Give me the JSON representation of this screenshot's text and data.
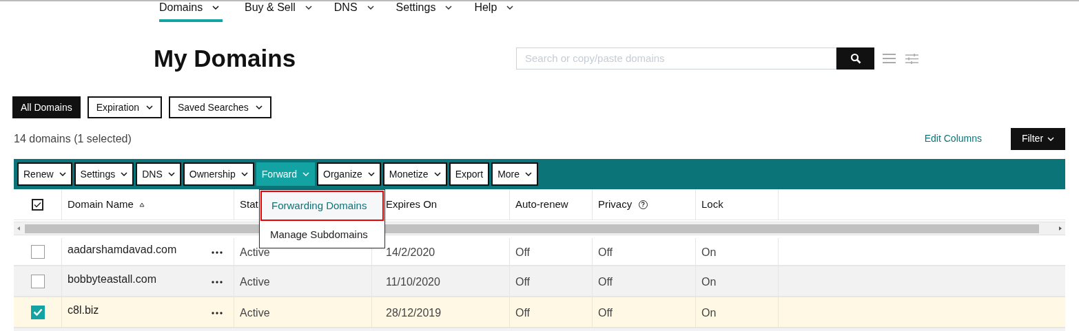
{
  "nav": [
    {
      "label": "Domains",
      "selected": true
    },
    {
      "label": "Buy & Sell",
      "selected": false
    },
    {
      "label": "DNS",
      "selected": false
    },
    {
      "label": "Settings",
      "selected": false
    },
    {
      "label": "Help",
      "selected": false
    }
  ],
  "title": "My Domains",
  "search": {
    "placeholder": "Search or copy/paste domains"
  },
  "filters": [
    {
      "label": "All Domains",
      "selected": true,
      "caret": false
    },
    {
      "label": "Expiration",
      "selected": false,
      "caret": true
    },
    {
      "label": "Saved Searches",
      "selected": false,
      "caret": true
    }
  ],
  "summary": "14 domains (1 selected)",
  "edit_columns": "Edit Columns",
  "filter_button": "Filter",
  "actions": [
    {
      "label": "Renew",
      "selected": false,
      "caret": true
    },
    {
      "label": "Settings",
      "selected": false,
      "caret": true
    },
    {
      "label": "DNS",
      "selected": false,
      "caret": true
    },
    {
      "label": "Ownership",
      "selected": false,
      "caret": true
    },
    {
      "label": "Forward",
      "selected": true,
      "caret": true
    },
    {
      "label": "Organize",
      "selected": false,
      "caret": true
    },
    {
      "label": "Monetize",
      "selected": false,
      "caret": true
    },
    {
      "label": "Export",
      "selected": false,
      "caret": false
    },
    {
      "label": "More",
      "selected": false,
      "caret": true
    }
  ],
  "menu": [
    {
      "label": "Forwarding Domains",
      "selected": true
    },
    {
      "label": "Manage Subdomains",
      "selected": false
    }
  ],
  "table": {
    "select_all": {
      "checked": true
    },
    "columns": [
      "Domain Name",
      "Stat",
      "Expires On",
      "Auto-renew",
      "Privacy",
      "Lock"
    ],
    "rows": [
      {
        "checked": false,
        "cells": [
          "aadarshamdavad.com",
          "Active",
          "14/2/2020",
          "Off",
          "Off",
          "On"
        ]
      },
      {
        "checked": false,
        "cells": [
          "bobbyteastall.com",
          "Active",
          "11/10/2020",
          "Off",
          "Off",
          "On"
        ]
      },
      {
        "checked": true,
        "cells": [
          "c8l.biz",
          "Active",
          "28/12/2019",
          "Off",
          "Off",
          "On"
        ]
      }
    ]
  }
}
